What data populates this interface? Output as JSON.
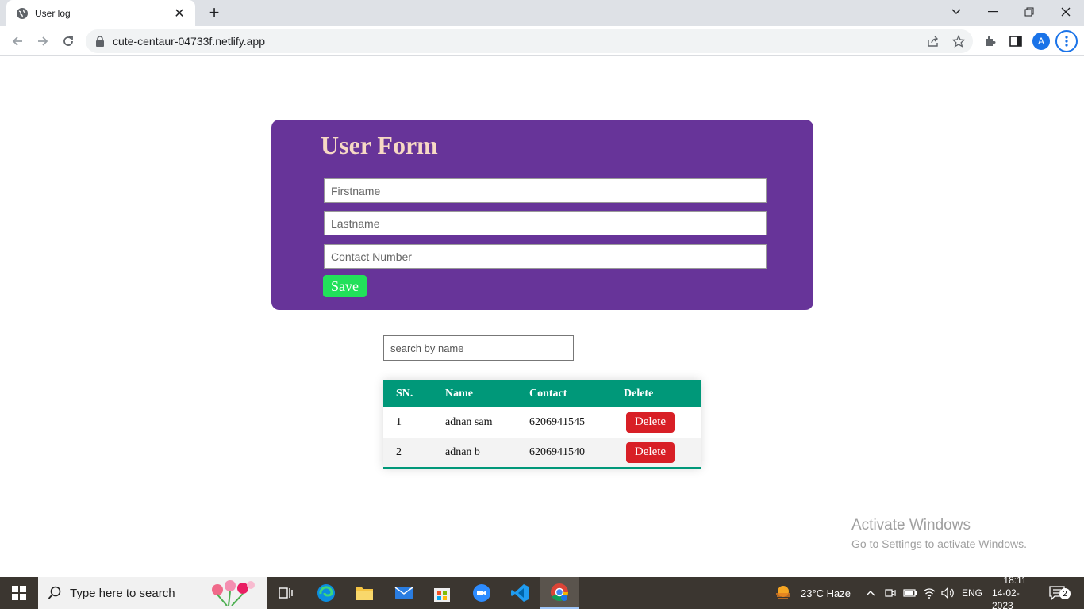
{
  "browser": {
    "tab_title": "User log",
    "url": "cute-centaur-04733f.netlify.app",
    "avatar_letter": "A"
  },
  "form": {
    "title": "User Form",
    "firstname_placeholder": "Firstname",
    "lastname_placeholder": "Lastname",
    "contact_placeholder": "Contact Number",
    "save_label": "Save"
  },
  "search": {
    "placeholder": "search by name"
  },
  "table": {
    "headers": [
      "SN.",
      "Name",
      "Contact",
      "Delete"
    ],
    "rows": [
      {
        "sn": "1",
        "name": "adnan sam",
        "contact": "6206941545",
        "action": "Delete"
      },
      {
        "sn": "2",
        "name": "adnan b",
        "contact": "6206941540",
        "action": "Delete"
      }
    ]
  },
  "watermark": {
    "line1": "Activate Windows",
    "line2": "Go to Settings to activate Windows."
  },
  "taskbar": {
    "search_text": "Type here to search",
    "weather": "23°C  Haze",
    "language": "ENG",
    "time": "18:11",
    "date": "14-02-2023",
    "notifications": "2"
  },
  "colors": {
    "form_bg": "#673499",
    "form_title": "#f7d9c4",
    "save_btn": "#22e05a",
    "table_header": "#009879",
    "delete_btn": "#d81f26"
  }
}
